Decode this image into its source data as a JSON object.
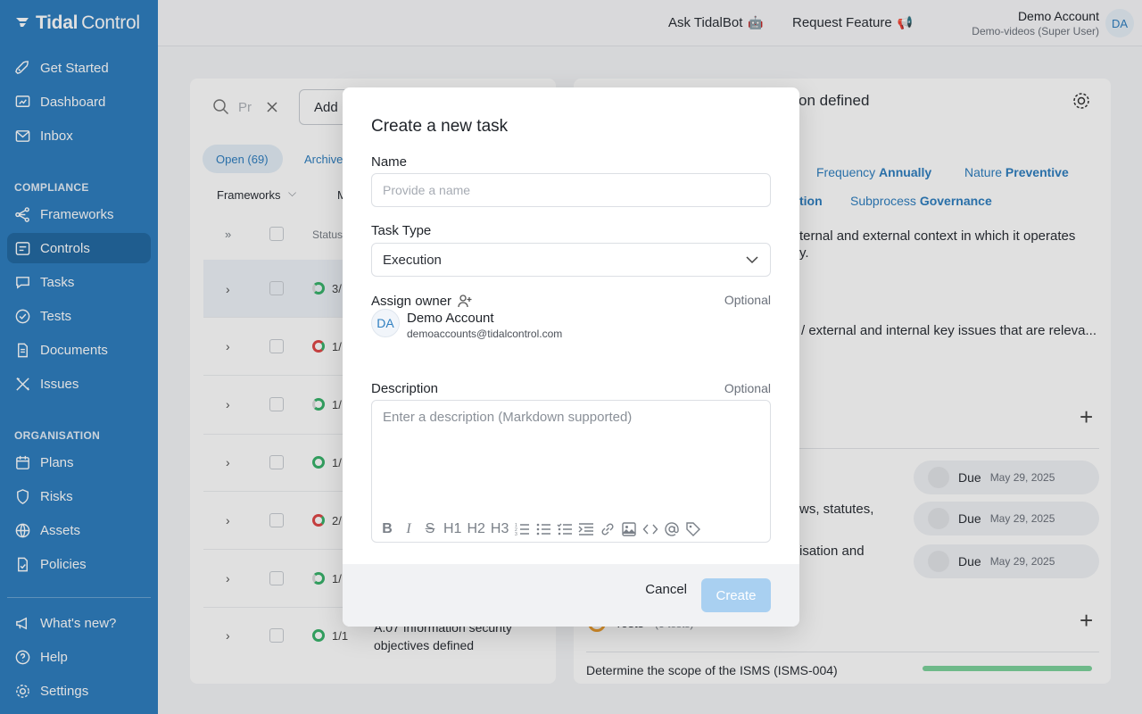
{
  "brand": {
    "name_bold": "Tidal",
    "name_light": "Control"
  },
  "sidebar": {
    "items_top": [
      {
        "label": "Get Started",
        "icon": "rocket-icon"
      },
      {
        "label": "Dashboard",
        "icon": "dashboard-icon"
      },
      {
        "label": "Inbox",
        "icon": "inbox-icon"
      }
    ],
    "compliance_label": "COMPLIANCE",
    "compliance_items": [
      {
        "label": "Frameworks",
        "icon": "frameworks-icon"
      },
      {
        "label": "Controls",
        "icon": "controls-icon",
        "active": true
      },
      {
        "label": "Tasks",
        "icon": "tasks-icon"
      },
      {
        "label": "Tests",
        "icon": "tests-icon"
      },
      {
        "label": "Documents",
        "icon": "documents-icon"
      },
      {
        "label": "Issues",
        "icon": "issues-icon"
      }
    ],
    "organisation_label": "ORGANISATION",
    "organisation_items": [
      {
        "label": "Plans",
        "icon": "calendar-icon"
      },
      {
        "label": "Risks",
        "icon": "shield-icon"
      },
      {
        "label": "Assets",
        "icon": "globe-icon"
      },
      {
        "label": "Policies",
        "icon": "policy-icon"
      }
    ],
    "bottom_items": [
      {
        "label": "What's new?",
        "icon": "megaphone-icon"
      },
      {
        "label": "Help",
        "icon": "help-icon"
      },
      {
        "label": "Settings",
        "icon": "gear-icon"
      }
    ]
  },
  "topbar": {
    "ask": "Ask TidalBot",
    "request": "Request Feature",
    "account_name": "Demo Account",
    "account_role": "Demo-videos (Super User)",
    "avatar": "DA"
  },
  "background": {
    "search_placeholder": "Pr",
    "add_button": "Add",
    "tab_open": "Open (69)",
    "tab_archived": "Archive",
    "filter_frameworks": "Frameworks",
    "filter_m": "M",
    "col_expand": "»",
    "col_status": "Status",
    "rows": [
      {
        "status": "3/",
        "ring": "half"
      },
      {
        "status": "1/",
        "ring": "red"
      },
      {
        "status": "1/",
        "ring": "half"
      },
      {
        "status": "1/",
        "ring": "full"
      },
      {
        "status": "2/",
        "ring": "red"
      },
      {
        "status": "1/",
        "ring": "half"
      },
      {
        "status": "1/1",
        "ring": "full"
      }
    ],
    "last_row_title_1": "A.07 Information security",
    "last_row_title_2": "objectives defined",
    "detail_title": "on defined",
    "frequency_label": "Frequency",
    "frequency_value": "Annually",
    "nature_label": "Nature",
    "nature_value": "Preventive",
    "tion": "tion",
    "subprocess_label": "Subprocess",
    "subprocess_value": "Governance",
    "desc_line1": "ternal and external context in which it operates",
    "desc_line2": "y.",
    "desc_line3": "/ external and internal key issues that are releva...",
    "laws": "ws, statutes,",
    "organisation_and": "isation and",
    "due_label": "Due",
    "due_dates": [
      "May 29, 2025",
      "May 29, 2025",
      "May 29, 2025"
    ],
    "tests_label": "Tests",
    "tests_count": "(3 tests)",
    "scope": "Determine the scope of the ISMS (ISMS-004)"
  },
  "modal": {
    "title": "Create a new task",
    "name_label": "Name",
    "name_placeholder": "Provide a name",
    "task_type_label": "Task Type",
    "task_type_value": "Execution",
    "assign_label": "Assign owner",
    "optional": "Optional",
    "owner_avatar": "DA",
    "owner_name": "Demo Account",
    "owner_email": "demoaccounts@tidalcontrol.com",
    "description_label": "Description",
    "description_placeholder": "Enter a description (Markdown supported)",
    "toolbar": [
      "B",
      "I",
      "S",
      "H1",
      "H2",
      "H3"
    ],
    "cancel": "Cancel",
    "create": "Create"
  }
}
